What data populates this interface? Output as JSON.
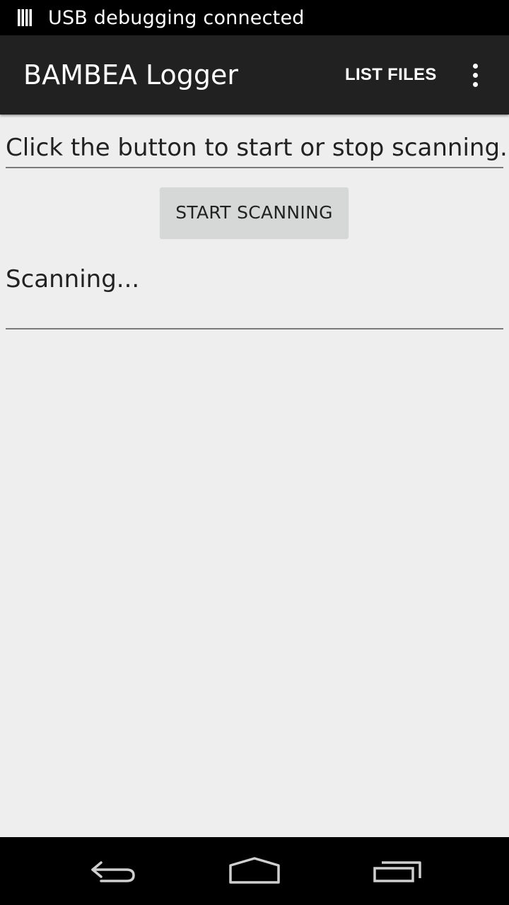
{
  "status_bar": {
    "notification_icon": "usb-debug-icon",
    "text": "USB debugging connected"
  },
  "action_bar": {
    "title": "BAMBEA Logger",
    "list_files_label": "LIST FILES",
    "overflow_icon": "overflow-menu-icon"
  },
  "main": {
    "instruction_text": "Click the button to start or stop scanning.",
    "start_button_label": "START SCANNING",
    "scan_status_text": "Scanning..."
  },
  "nav_bar": {
    "back_icon": "back-icon",
    "home_icon": "home-icon",
    "recents_icon": "recent-apps-icon"
  },
  "colors": {
    "status_bar_bg": "#000000",
    "action_bar_bg": "#212121",
    "content_bg": "#eeeeee",
    "button_bg": "#d6d7d7",
    "divider": "#7a7a7a"
  }
}
